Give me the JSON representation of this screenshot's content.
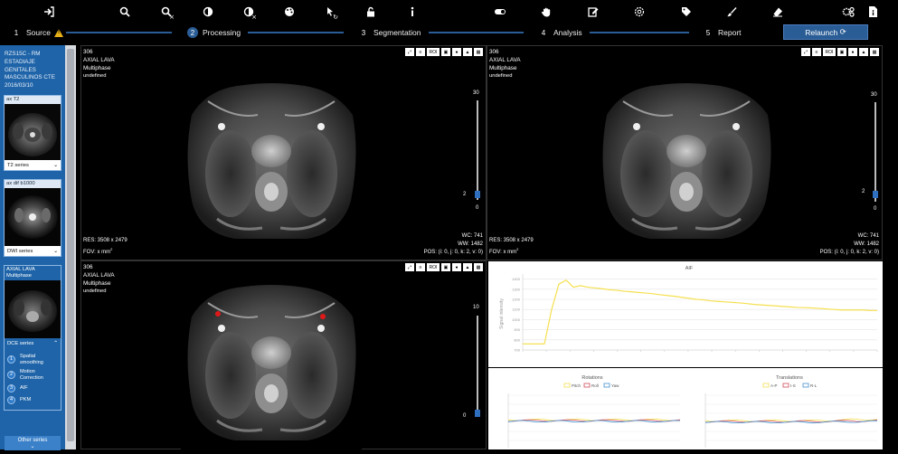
{
  "toolbar": {
    "icons": [
      "sign-in-icon",
      "search-icon",
      "search-x-icon",
      "contrast-icon",
      "contrast-x-icon",
      "palette-icon",
      "pointer-refresh-icon",
      "unlock-icon",
      "info-icon",
      "toggle-icon",
      "hand-icon",
      "edit-icon",
      "settings-icon",
      "tags-icon",
      "brush-icon",
      "eraser-icon",
      "cogs-icon",
      "file-info-icon"
    ]
  },
  "workflow": {
    "steps": [
      {
        "num": "1",
        "label": "Source"
      },
      {
        "num": "2",
        "label": "Processing"
      },
      {
        "num": "3",
        "label": "Segmentation"
      },
      {
        "num": "4",
        "label": "Analysis"
      },
      {
        "num": "5",
        "label": "Report"
      }
    ],
    "relaunch_label": "Relaunch"
  },
  "sidebar": {
    "patient_lines": [
      "RZS15C - RM",
      "ESTADIAJE",
      "GENITALES",
      "MASCULINOS CTE",
      "2016/03/10"
    ],
    "cards": [
      {
        "label": "ax T2",
        "select": "T2 series"
      },
      {
        "label": "ax dif b1000",
        "select": "DWI series"
      },
      {
        "label_1": "AXIAL LAVA",
        "label_2": "Multiphase",
        "select": "DCE series",
        "steps": [
          {
            "n": "1",
            "t1": "Spatial",
            "t2": "smoothing"
          },
          {
            "n": "2",
            "t1": "Motion",
            "t2": "Correction"
          },
          {
            "n": "3",
            "t1": "AIF",
            "t2": ""
          },
          {
            "n": "4",
            "t1": "PKM",
            "t2": ""
          }
        ]
      }
    ],
    "other_label": "Other series"
  },
  "viewports": [
    {
      "id": "306",
      "line1": "AXIAL LAVA",
      "line2": "Multiphase",
      "line3": "undefined",
      "res": "RES: 3508 x 2479",
      "fov": "FOV: x mm",
      "wc": "WC: 741",
      "ww": "WW: 1482",
      "pos": "POS: (i: 0, j: 0, k: 2, v: 0)",
      "slider_max": "30",
      "slider_val": "2",
      "slider_min": "0"
    },
    {
      "id": "306",
      "line1": "AXIAL LAVA",
      "line2": "Multiphase",
      "line3": "undefined",
      "res": "RES: 3508 x 2479",
      "fov": "FOV: x mm",
      "wc": "WC: 741",
      "ww": "WW: 1482",
      "pos": "POS: (i: 0, j: 0, k: 2, v: 0)",
      "slider_max": "30",
      "slider_val": "2",
      "slider_min": "0"
    },
    {
      "id": "306",
      "line1": "AXIAL LAVA",
      "line2": "Multiphase",
      "line3": "undefined",
      "slider_max": "10",
      "slider_val": "0"
    }
  ],
  "viewport_tools": [
    "expand-icon",
    "list-icon",
    "ROI",
    "save-icon",
    "palette-icon",
    "lock-icon",
    "grid-icon"
  ],
  "superscript": "2",
  "chart_data": [
    {
      "type": "line",
      "title": "AIF",
      "ylabel": "Signal intensity",
      "ylim": [
        700,
        1450
      ],
      "y_ticks": [
        700,
        800,
        900,
        1000,
        1100,
        1200,
        1300,
        1400
      ],
      "series": [
        {
          "color": "#f5e050",
          "values": [
            760,
            760,
            760,
            760,
            1100,
            1350,
            1390,
            1320,
            1335,
            1320,
            1312,
            1305,
            1295,
            1290,
            1280,
            1275,
            1268,
            1262,
            1255,
            1245,
            1238,
            1230,
            1220,
            1210,
            1200,
            1195,
            1185,
            1180,
            1175,
            1170,
            1165,
            1158,
            1150,
            1145,
            1140,
            1135,
            1130,
            1125,
            1120,
            1118,
            1115,
            1110,
            1105,
            1100,
            1095,
            1095,
            1095,
            1095,
            1090,
            1090
          ]
        }
      ]
    },
    {
      "type": "line",
      "title": "Rotations",
      "legend": [
        "Pitch",
        "Roll",
        "Yaw"
      ],
      "colors": [
        "#f5e050",
        "#d04a5a",
        "#3f8fcf"
      ]
    },
    {
      "type": "line",
      "title": "Translations",
      "legend": [
        "A-P",
        "I-S",
        "R-L"
      ],
      "colors": [
        "#f5e050",
        "#d04a5a",
        "#3f8fcf"
      ]
    }
  ]
}
